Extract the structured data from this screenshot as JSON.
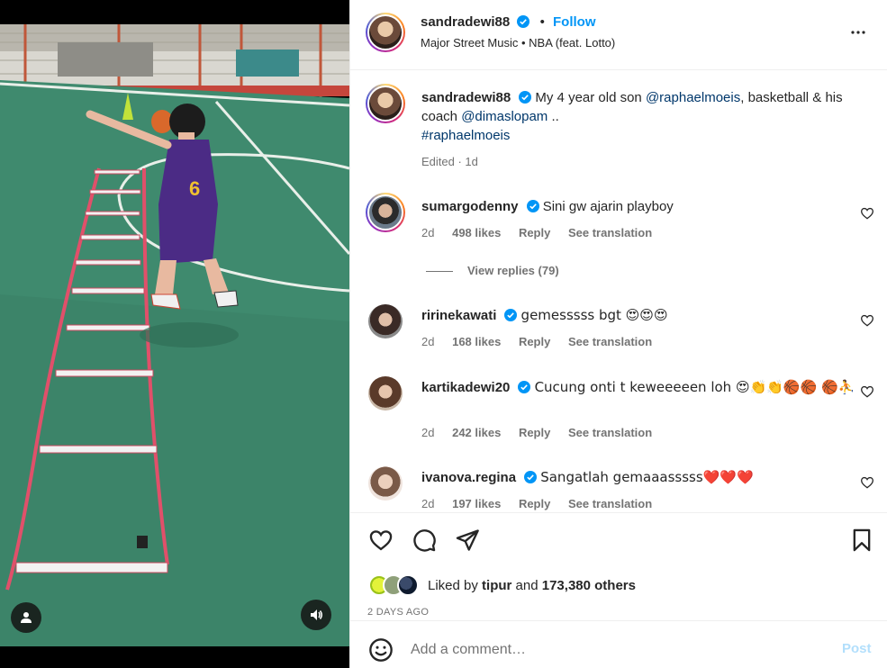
{
  "post": {
    "author": "sandradewi88",
    "follow_label": "Follow",
    "audio": "Major Street Music • NBA (feat. Lotto)",
    "dot": "•"
  },
  "caption": {
    "username": "sandradewi88",
    "text_before": "My 4 year old son ",
    "mention1": "@raphaelmoeis",
    "text_mid": ", basketball & his coach ",
    "mention2": "@dimaslopam",
    "text_after": " ..",
    "hashtag": "#raphaelmoeis",
    "meta": "Edited · 1d"
  },
  "comments": [
    {
      "username": "sumargodenny",
      "text": "Sini gw ajarin playboy",
      "time": "2d",
      "likes": "498 likes",
      "reply": "Reply",
      "translate": "See translation"
    },
    {
      "username": "ririnekawati",
      "text": "gemesssss bgt 😍😍😍",
      "time": "2d",
      "likes": "168 likes",
      "reply": "Reply",
      "translate": "See translation"
    },
    {
      "username": "kartikadewi20",
      "text": "Cucung onti t keweeeeen loh 😍👏👏🏀🏀 🏀⛹",
      "time": "2d",
      "likes": "242 likes",
      "reply": "Reply",
      "translate": "See translation"
    },
    {
      "username": "ivanova.regina",
      "text": "Sangatlah gemaaasssss❤️❤️❤️",
      "time": "2d",
      "likes": "197 likes",
      "reply": "Reply",
      "translate": "See translation"
    }
  ],
  "view_replies": "View replies (79)",
  "likes": {
    "prefix": "Liked by",
    "user": "tipur",
    "joiner": "and",
    "others": "173,380 others"
  },
  "post_date": "2 DAYS AGO",
  "comment_box": {
    "placeholder": "Add a comment…",
    "post_label": "Post"
  },
  "icons": [
    "more-icon",
    "heart-icon",
    "comment-icon",
    "share-icon",
    "bookmark-icon",
    "emoji-icon",
    "user-tag-icon",
    "sound-icon",
    "verified-icon"
  ],
  "colors": {
    "accent": "#0095f6",
    "verified": "#0095f6",
    "mention": "#00376b",
    "muted": "#737373",
    "post_disabled": "#b2dffc",
    "court": "#3f8a6e"
  }
}
